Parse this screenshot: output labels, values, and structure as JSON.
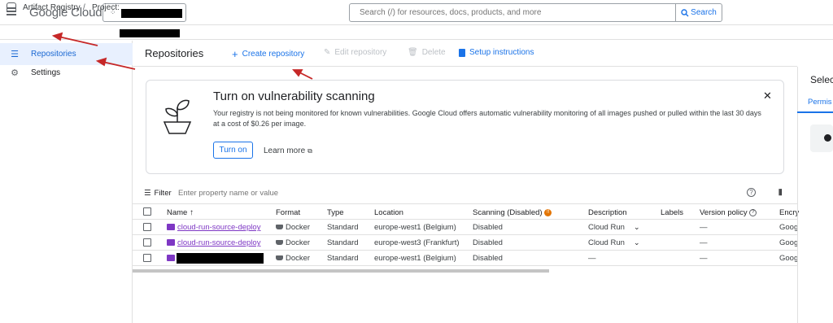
{
  "topbar": {
    "logo_google": "Google",
    "logo_cloud": "Cloud",
    "search_placeholder": "Search (/) for resources, docs, products, and more",
    "search_button": "Search"
  },
  "breadcrumb": {
    "product": "Artifact Registry",
    "separator": "/",
    "project_label": "Project:"
  },
  "sidebar": {
    "items": [
      {
        "label": "Repositories",
        "icon": "list-icon",
        "active": true
      },
      {
        "label": "Settings",
        "icon": "gear-icon",
        "active": false
      }
    ]
  },
  "header": {
    "title": "Repositories",
    "actions": [
      {
        "label": "Create repository",
        "icon": "+",
        "enabled": true
      },
      {
        "label": "Edit repository",
        "icon": "pencil-icon",
        "enabled": false
      },
      {
        "label": "Delete",
        "icon": "trash-icon",
        "enabled": false
      },
      {
        "label": "Setup instructions",
        "icon": "doc-icon",
        "enabled": true
      }
    ]
  },
  "banner": {
    "title": "Turn on vulnerability scanning",
    "text": "Your registry is not being monitored for known vulnerabilities. Google Cloud offers automatic vulnerability monitoring of all images pushed or pulled within the last 30 days at a cost of $0.26 per image.",
    "turn_on": "Turn on",
    "learn_more": "Learn more"
  },
  "filter": {
    "label": "Filter",
    "placeholder": "Enter property name or value"
  },
  "table": {
    "columns": [
      "Name",
      "Format",
      "Type",
      "Location",
      "Scanning (Disabled)",
      "Description",
      "Labels",
      "Version policy",
      "Encry"
    ],
    "rows": [
      {
        "name": "cloud-run-source-deploy",
        "format": "Docker",
        "type": "Standard",
        "location": "europe-west1 (Belgium)",
        "scanning": "Disabled",
        "description": "Cloud Run",
        "version_policy": "—",
        "encryption": "Goog"
      },
      {
        "name": "cloud-run-source-deploy",
        "format": "Docker",
        "type": "Standard",
        "location": "europe-west3 (Frankfurt)",
        "scanning": "Disabled",
        "description": "Cloud Run",
        "version_policy": "—",
        "encryption": "Goog"
      },
      {
        "name": "",
        "format": "Docker",
        "type": "Standard",
        "location": "europe-west1 (Belgium)",
        "scanning": "Disabled",
        "description": "—",
        "version_policy": "—",
        "encryption": "Goog"
      }
    ]
  },
  "right_panel": {
    "title": "Selec",
    "tab": "Permis"
  },
  "colors": {
    "accent": "#1a73e8",
    "repo_purple": "#7e37c4",
    "annotation_red": "#c62828"
  }
}
